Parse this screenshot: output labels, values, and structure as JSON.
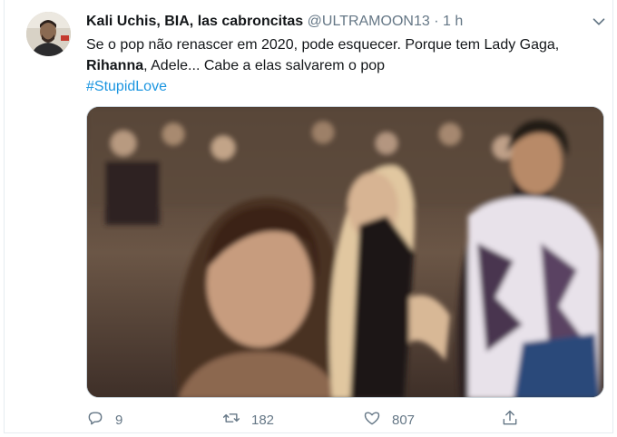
{
  "tweet": {
    "author_name": "Kali Uchis, BIA, las cabroncitas",
    "handle": "@ULTRAMOON13",
    "separator": "·",
    "time": "1 h",
    "text_part1": "Se o pop não renascer em 2020, pode esquecer. Porque tem Lady Gaga,",
    "text_bold": "Rihanna",
    "text_part2": ", Adele... Cabe a elas salvarem o pop",
    "hashtag": "#StupidLove"
  },
  "actions": {
    "replies": "9",
    "retweets": "182",
    "likes": "807"
  },
  "colors": {
    "link": "#1b95e0",
    "secondary": "#657786"
  },
  "icons": [
    "reply-icon",
    "retweet-icon",
    "like-icon",
    "share-icon",
    "chevron-down-icon"
  ]
}
